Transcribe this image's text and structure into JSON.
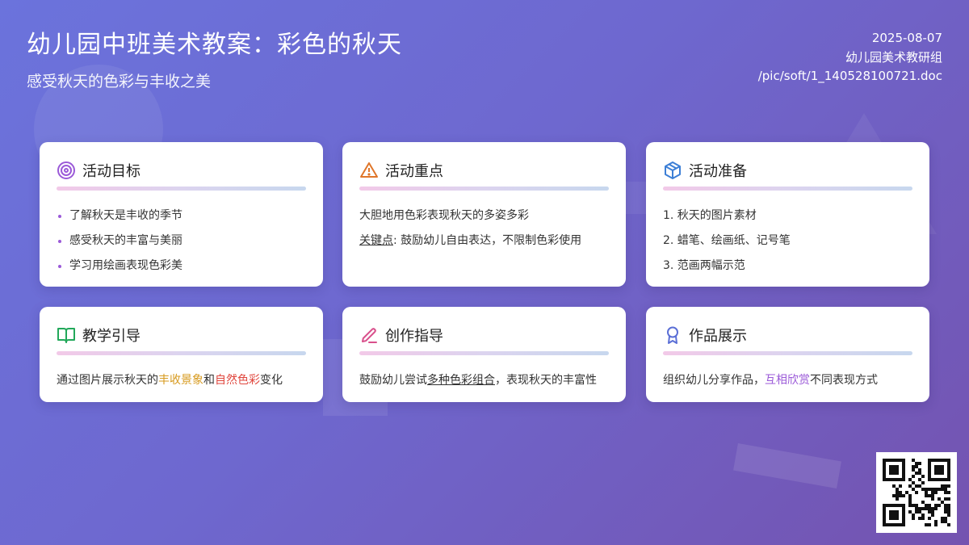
{
  "header": {
    "title": "幼儿园中班美术教案：彩色的秋天",
    "subtitle": "感受秋天的色彩与丰收之美",
    "date": "2025-08-07",
    "author": "幼儿园美术教研组",
    "file_path": "/pic/soft/1_140528100721.doc"
  },
  "cards": {
    "goals": {
      "title": "活动目标",
      "icon": "target-icon",
      "items": [
        "了解秋天是丰收的季节",
        "感受秋天的丰富与美丽",
        "学习用绘画表现色彩美"
      ]
    },
    "focus": {
      "title": "活动重点",
      "icon": "warning-icon",
      "line1": "大胆地用色彩表现秋天的多姿多彩",
      "key_label": "关键点",
      "key_text": ": 鼓励幼儿自由表达，不限制色彩使用"
    },
    "prep": {
      "title": "活动准备",
      "icon": "box-icon",
      "items": [
        "1. 秋天的图片素材",
        "2. 蜡笔、绘画纸、记号笔",
        "3. 范画两幅示范"
      ]
    },
    "teaching": {
      "title": "教学引导",
      "icon": "book-icon",
      "text_a": "通过图片展示秋天的",
      "hl1": "丰收景象",
      "text_b": "和",
      "hl2": "自然色彩",
      "text_c": "变化"
    },
    "creation": {
      "title": "创作指导",
      "icon": "pencil-icon",
      "text_a": "鼓励幼儿尝试",
      "hl": "多种色彩组合",
      "text_b": "，表现秋天的丰富性"
    },
    "display": {
      "title": "作品展示",
      "icon": "award-icon",
      "text_a": "组织幼儿分享作品，",
      "hl": "互相欣赏",
      "text_b": "不同表现方式"
    }
  },
  "qr": {
    "icon": "qr-code-icon"
  },
  "colors": {
    "accent_purple": "#9b5ad8",
    "highlight_gold": "#d79a1e",
    "highlight_red": "#e0463d",
    "icon_orange": "#e0762a",
    "icon_blue": "#3d7fd6",
    "icon_green": "#22a85a",
    "icon_pink": "#d9508c",
    "icon_indigo": "#5b6fd6"
  }
}
